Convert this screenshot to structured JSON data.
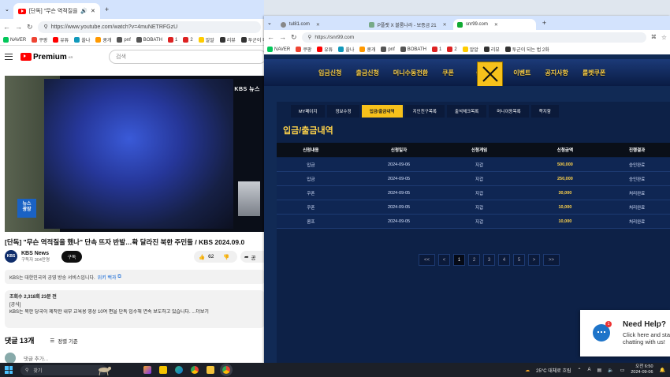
{
  "left": {
    "tab": {
      "title": "[단독] \"무슨 역적질을 했나\" 단속",
      "new_tab": "+"
    },
    "url": "https://www.youtube.com/watch?v=4muNETRFGzU",
    "bookmarks": [
      "NAVER",
      "쿠팡",
      "유튜",
      "쏠나",
      "쿵개",
      "pnf",
      "BOBATH",
      "1",
      "2",
      "알알",
      "리뷰",
      "투군이 되"
    ],
    "yt": {
      "brand": "Premium",
      "brand_sup": "KR",
      "search_placeholder": "검색"
    },
    "video": {
      "kbs_mark": "KBS 뉴스",
      "news_badge": "뉴스\n광장"
    },
    "title": "[단독] \"무슨 역적질을 했나\" 단속 뜨자 반발…확 달라진 북한 주민들 / KBS 2024.09.0",
    "channel": {
      "name": "KBS News",
      "subs": "구독자 304만명",
      "avatar": "KBS"
    },
    "subscribe": "구독",
    "likes": "62",
    "share": "공",
    "info": {
      "text": "KBS는 대한민국의 공영 방송 서비스입니다.",
      "link": "위키 백과"
    },
    "desc": {
      "line1": "조회수 2,318회  23분 전",
      "line2": "[공식]",
      "line3": "KBS는 북한 당국이 제작한 내부 교육용 영상 10여 편을 단독 입수해 연속 보도하고 있습니다. ...더보기"
    },
    "comments": {
      "count": "댓글 13개",
      "sort": "정렬 기준",
      "placeholder": "댓글 추가..."
    }
  },
  "right": {
    "tabs": [
      {
        "title": "tul81.com"
      },
      {
        "title": "P플랫 X 블룸나라 - 보증금 21"
      },
      {
        "title": "snr99.com"
      }
    ],
    "new_tab": "+",
    "url": "https://snr99.com",
    "bookmarks": [
      "NAVER",
      "쿠팡",
      "유튜",
      "쏠나",
      "쿵개",
      "pnf",
      "BOBATH",
      "1",
      "2",
      "알알",
      "리뷰",
      "투군이 되는 법 2화"
    ],
    "nav": [
      "입금신청",
      "출금신청",
      "머니수동전환",
      "쿠폰",
      "콤프신청",
      "이벤트",
      "공지사항",
      "룰렛쿠폰"
    ],
    "subtabs": [
      "MY페이지",
      "정보수정",
      "입금/출금내역",
      "지인친구목록",
      "출석체크목록",
      "머니이동목록",
      "쪽지함"
    ],
    "active_subtab": 2,
    "section_title": "입금/출금내역",
    "table": {
      "headers": [
        "신청내용",
        "신청일자",
        "신청게임",
        "신청금액",
        "진행결과"
      ],
      "rows": [
        [
          "입금",
          "2024-09-06",
          "지갑",
          "500,000",
          "승인완료"
        ],
        [
          "입금",
          "2024-09-05",
          "지갑",
          "250,000",
          "승인완료"
        ],
        [
          "쿠폰",
          "2024-09-05",
          "지갑",
          "30,000",
          "처리완료"
        ],
        [
          "쿠폰",
          "2024-09-05",
          "지갑",
          "10,000",
          "처리완료"
        ],
        [
          "콤프",
          "2024-09-05",
          "지갑",
          "10,000",
          "처리완료"
        ]
      ]
    },
    "pager": [
      "<<",
      "<",
      "1",
      "2",
      "3",
      "4",
      "5",
      ">",
      ">>"
    ],
    "active_page": "1",
    "help": {
      "title": "Need Help?",
      "sub1": "Click here and sta",
      "sub2": "chatting with us!",
      "badge": "1"
    }
  },
  "taskbar": {
    "search": "찾기",
    "weather": "25°C  대체로 흐림",
    "time": "오전 6:50",
    "date": "2024-09-06",
    "lang": "A"
  }
}
